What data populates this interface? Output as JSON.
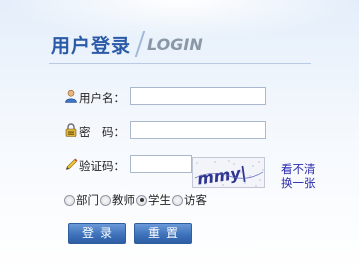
{
  "header": {
    "title_cn": "用户登录",
    "title_en": "LOGIN"
  },
  "form": {
    "username_label": "用户名：",
    "password_label": "密　码：",
    "captcha_label": "验证码：",
    "username_value": "",
    "password_value": "",
    "captcha_value": "",
    "captcha_text": "mmy|",
    "refresh_link": [
      "看不清",
      "换一张"
    ]
  },
  "roles": [
    {
      "label": "部门",
      "checked": false
    },
    {
      "label": "教师",
      "checked": false
    },
    {
      "label": "学生",
      "checked": true
    },
    {
      "label": "访客",
      "checked": false
    }
  ],
  "buttons": {
    "login": "登录",
    "reset": "重置"
  },
  "colors": {
    "title": "#2a5aa8",
    "button": "#3e72bb",
    "link": "#2b2bb0"
  }
}
